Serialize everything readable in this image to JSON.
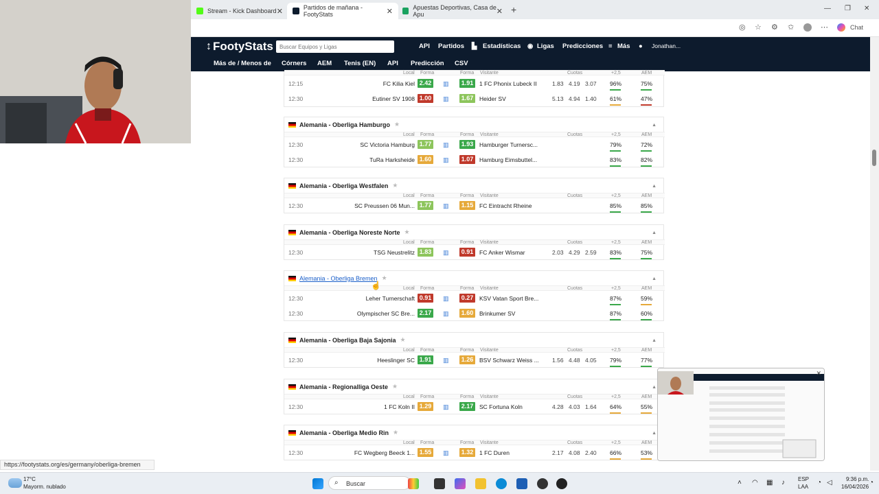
{
  "browser": {
    "tabs": [
      {
        "title": "Stream - Kick Dashboard",
        "color": "#53fc18"
      },
      {
        "title": "Partidos de mañana - FootyStats",
        "color": "#0d1b2d"
      },
      {
        "title": "Apuestas Deportivas, Casa de Apu",
        "color": "#1aa260"
      }
    ],
    "chat_label": "Chat",
    "status_url": "https://footystats.org/es/germany/oberliga-bremen"
  },
  "site": {
    "logo": "FootyStats",
    "search_placeholder": "Buscar Equipos y Ligas",
    "nav_top": [
      "API",
      "Partidos",
      "Estadísticas",
      "Ligas",
      "Predicciones",
      "Más",
      "Jonathan..."
    ],
    "nav_sub": [
      "Más de / Menos de",
      "Córners",
      "AEM",
      "Tenis (EN)",
      "API",
      "Predicción",
      "CSV"
    ]
  },
  "columns": {
    "local": "Local",
    "forma": "Forma",
    "visitante": "Visitante",
    "cuotas": "Cuotas",
    "over": "+2,5",
    "aem": "AEM"
  },
  "colors": {
    "green": "#3aa84a",
    "lightgreen": "#8dc55c",
    "yellow": "#e6a93a",
    "red": "#c0392b",
    "navy": "#0d1b2d"
  },
  "first_block": {
    "matches": [
      {
        "time": "12:15",
        "home": "FC Kilia Kiel",
        "hf": "2.42",
        "hc": "green",
        "af": "1.91",
        "ac": "green",
        "away": "1 FC Phonix Lubeck II",
        "odds": [
          "1.83",
          "4.19",
          "3.07"
        ],
        "over": "96%",
        "aem": "75%"
      },
      {
        "time": "12:30",
        "home": "Eutiner SV 1908",
        "hf": "1.00",
        "hc": "red",
        "af": "1.67",
        "ac": "lightgreen",
        "away": "Heider SV",
        "odds": [
          "5.13",
          "4.94",
          "1.40"
        ],
        "over": "61%",
        "aem": "47%"
      }
    ]
  },
  "leagues": [
    {
      "name": "Alemania - Oberliga Hamburgo",
      "matches": [
        {
          "time": "12:30",
          "home": "SC Victoria Hamburg",
          "hf": "1.77",
          "hc": "lightgreen",
          "af": "1.93",
          "ac": "green",
          "away": "Hamburger Turnersc...",
          "odds": [
            "",
            "",
            ""
          ],
          "over": "79%",
          "aem": "72%"
        },
        {
          "time": "12:30",
          "home": "TuRa Harksheide",
          "hf": "1.60",
          "hc": "yellow",
          "af": "1.07",
          "ac": "red",
          "away": "Hamburg Eimsbuttel...",
          "odds": [
            "",
            "",
            ""
          ],
          "over": "83%",
          "aem": "82%"
        }
      ]
    },
    {
      "name": "Alemania - Oberliga Westfalen",
      "matches": [
        {
          "time": "12:30",
          "home": "SC Preussen 06 Mun...",
          "hf": "1.77",
          "hc": "lightgreen",
          "af": "1.15",
          "ac": "yellow",
          "away": "FC Eintracht Rheine",
          "odds": [
            "",
            "",
            ""
          ],
          "over": "85%",
          "aem": "85%"
        }
      ]
    },
    {
      "name": "Alemania - Oberliga Noreste Norte",
      "matches": [
        {
          "time": "12:30",
          "home": "TSG Neustrelitz",
          "hf": "1.83",
          "hc": "lightgreen",
          "af": "0.91",
          "ac": "red",
          "away": "FC Anker Wismar",
          "odds": [
            "2.03",
            "4.29",
            "2.59"
          ],
          "over": "83%",
          "aem": "75%"
        }
      ]
    },
    {
      "name": "Alemania - Oberliga Bremen",
      "matches": [
        {
          "time": "12:30",
          "home": "Leher Turnerschaft",
          "hf": "0.91",
          "hc": "red",
          "af": "0.27",
          "ac": "red",
          "away": "KSV Vatan Sport Bre...",
          "odds": [
            "",
            "",
            ""
          ],
          "over": "87%",
          "aem": "59%"
        },
        {
          "time": "12:30",
          "home": "Olympischer SC Bre...",
          "hf": "2.17",
          "hc": "green",
          "af": "1.60",
          "ac": "yellow",
          "away": "Brinkumer SV",
          "odds": [
            "",
            "",
            ""
          ],
          "over": "87%",
          "aem": "60%"
        }
      ]
    },
    {
      "name": "Alemania - Oberliga Baja Sajonia",
      "matches": [
        {
          "time": "12:30",
          "home": "Heeslinger SC",
          "hf": "1.91",
          "hc": "green",
          "af": "1.26",
          "ac": "yellow",
          "away": "BSV Schwarz Weiss ...",
          "odds": [
            "1.56",
            "4.48",
            "4.05"
          ],
          "over": "79%",
          "aem": "77%"
        }
      ]
    },
    {
      "name": "Alemania - Regionalliga Oeste",
      "matches": [
        {
          "time": "12:30",
          "home": "1 FC Koln II",
          "hf": "1.29",
          "hc": "yellow",
          "af": "2.17",
          "ac": "green",
          "away": "SC Fortuna Koln",
          "odds": [
            "4.28",
            "4.03",
            "1.64"
          ],
          "over": "64%",
          "aem": "55%"
        }
      ]
    },
    {
      "name": "Alemania - Oberliga Medio Rin",
      "matches": [
        {
          "time": "12:30",
          "home": "FC Wegberg Beeck 1...",
          "hf": "1.55",
          "hc": "yellow",
          "af": "1.32",
          "ac": "yellow",
          "away": "1 FC Duren",
          "odds": [
            "2.17",
            "4.08",
            "2.40"
          ],
          "over": "66%",
          "aem": "53%"
        }
      ]
    }
  ],
  "taskbar": {
    "weather_temp": "17°C",
    "weather_desc": "Mayorm. nublado",
    "search": "Buscar",
    "lang_top": "ESP",
    "lang_bottom": "LAA",
    "time": "9:36 p.m.",
    "date": "16/04/2026"
  }
}
